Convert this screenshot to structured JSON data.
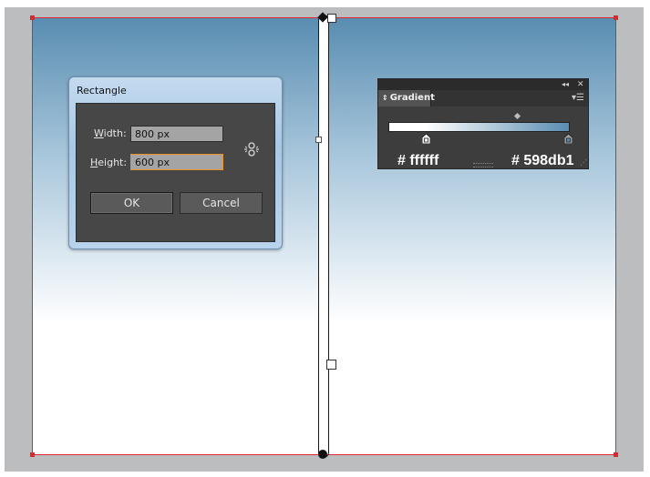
{
  "dialog": {
    "title": "Rectangle",
    "width_label_accel": "W",
    "width_label_rest": "idth:",
    "width_value": "800 px",
    "height_label_accel": "H",
    "height_label_rest": "eight:",
    "height_value": "600 px",
    "ok_label": "OK",
    "cancel_label": "Cancel",
    "constrain_icon": "chain-link-icon"
  },
  "gradient_panel": {
    "tab_label": "Gradient",
    "stops": [
      {
        "color": "#ffffff",
        "label": "# ffffff"
      },
      {
        "color": "#598db1",
        "label": "# 598db1"
      }
    ],
    "icons": [
      "collapse-icon",
      "close-icon",
      "panel-menu-icon"
    ]
  },
  "artboard": {
    "gradient_top": "#598db1",
    "gradient_bottom": "#ffffff",
    "border_color": "#e0262a"
  }
}
